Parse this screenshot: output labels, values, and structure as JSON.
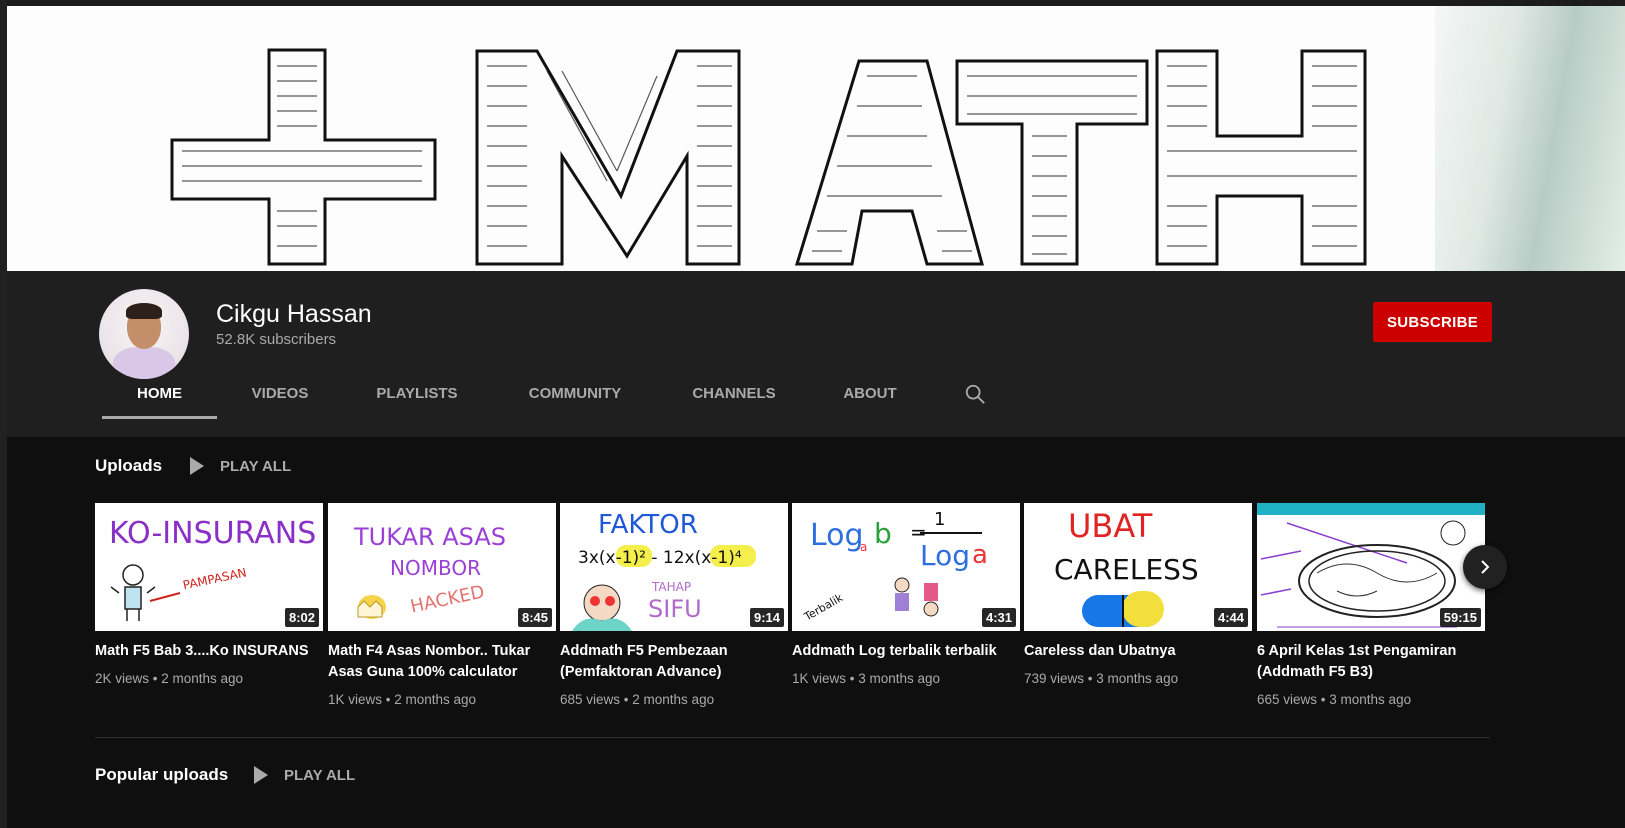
{
  "banner": {
    "text": "+MATH"
  },
  "channel": {
    "name": "Cikgu Hassan",
    "subscribers": "52.8K subscribers",
    "subscribe_label": "SUBSCRIBE"
  },
  "tabs": [
    {
      "label": "HOME",
      "active": true
    },
    {
      "label": "VIDEOS"
    },
    {
      "label": "PLAYLISTS"
    },
    {
      "label": "COMMUNITY"
    },
    {
      "label": "CHANNELS"
    },
    {
      "label": "ABOUT"
    }
  ],
  "uploads": {
    "title": "Uploads",
    "play_all": "PLAY ALL",
    "videos": [
      {
        "title": "Math F5 Bab 3....Ko INSURANS",
        "views": "2K views",
        "age": "2 months ago",
        "duration": "8:02",
        "thumb_text": "KO-INSURANS",
        "thumb_sub": "PAMPASAN"
      },
      {
        "title": "Math F4 Asas Nombor.. Tukar Asas Guna 100% calculator",
        "views": "1K views",
        "age": "2 months ago",
        "duration": "8:45",
        "thumb_text": "TUKAR ASAS",
        "thumb_sub": "NOMBOR",
        "thumb_sub2": "HACKED"
      },
      {
        "title": "Addmath F5 Pembezaan (Pemfaktoran Advance)",
        "views": "685 views",
        "age": "2 months ago",
        "duration": "9:14",
        "thumb_text": "FAKTOR",
        "thumb_sub": "TAHAP",
        "thumb_sub2": "SIFU"
      },
      {
        "title": "Addmath Log terbalik terbalik",
        "views": "1K views",
        "age": "3 months ago",
        "duration": "4:31",
        "thumb_text": "Log",
        "thumb_sub": "Log",
        "thumb_sub2": "Terbalik"
      },
      {
        "title": "Careless dan Ubatnya",
        "views": "739 views",
        "age": "3 months ago",
        "duration": "4:44",
        "thumb_text": "UBAT",
        "thumb_sub": "CARELESS"
      },
      {
        "title": "6 April Kelas 1st Pengamiran (Addmath F5 B3)",
        "views": "665 views",
        "age": "3 months ago",
        "duration": "59:15",
        "thumb_text": ""
      }
    ]
  },
  "popular": {
    "title": "Popular uploads",
    "play_all": "PLAY ALL"
  }
}
